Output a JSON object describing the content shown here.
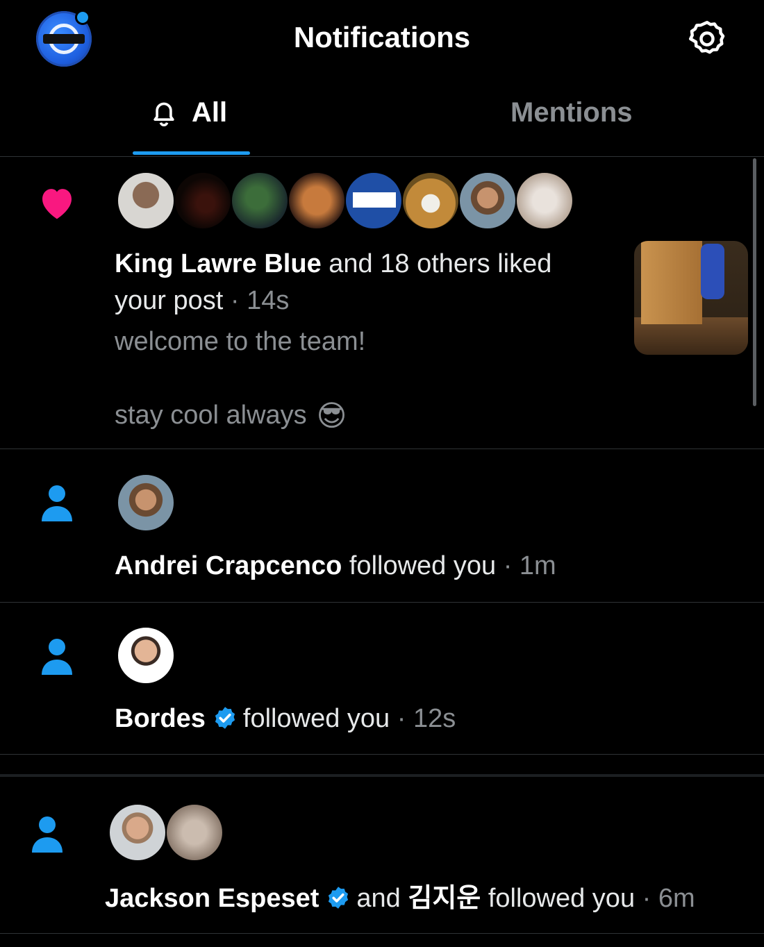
{
  "header": {
    "title": "Notifications",
    "logo_icon": "profile-avatar-icon",
    "settings_icon": "gear-icon"
  },
  "tabs": [
    {
      "label": "All",
      "icon": "bell-icon",
      "active": true
    },
    {
      "label": "Mentions",
      "active": false
    }
  ],
  "colors": {
    "accent": "#1d9bf0",
    "like": "#f91880",
    "muted": "#8b8f93",
    "divider": "#2f3336"
  },
  "notifications": [
    {
      "type": "like",
      "icon": "heart-icon",
      "avatar_count": 8,
      "actor": "King Lawre Blue",
      "action": "and 18 others liked your post",
      "sep": "·",
      "time": "14s",
      "post_line1": "welcome to the team!",
      "post_line2": "stay cool always",
      "emoji": "😎",
      "has_thumbnail": true
    },
    {
      "type": "follow",
      "icon": "person-icon",
      "actor": "Andrei Crapcenco",
      "action": "followed you",
      "sep": "·",
      "time": "1m"
    },
    {
      "type": "follow",
      "icon": "person-icon",
      "actor": "Bordes",
      "verified": true,
      "action": "followed you",
      "sep": "·",
      "time": "12s"
    },
    {
      "type": "follow",
      "icon": "person-icon",
      "actor": "Jackson Espeset",
      "verified": true,
      "joiner": "and",
      "actor2": "김지운",
      "action": "followed you",
      "sep": "·",
      "time": "6m"
    }
  ]
}
